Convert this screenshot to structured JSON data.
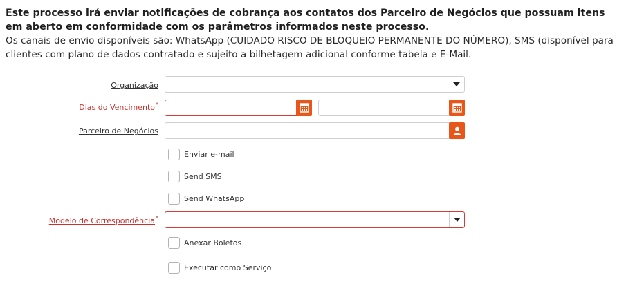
{
  "intro": {
    "bold_text": "Este processo irá enviar notificações de cobrança aos contatos dos Parceiro de Negócios que possuam itens em aberto em conformidade com os parâmetros informados neste processo.",
    "normal_text": "Os canais de envio disponíveis são: WhatsApp (CUIDADO RISCO DE BLOQUEIO PERMANENTE DO NÚMERO), SMS (disponível para clientes com plano de dados contratado e sujeito a bilhetagem adicional conforme tabela e E-Mail."
  },
  "form": {
    "organizacao": {
      "label": "Organização",
      "value": "",
      "required": false
    },
    "dias_vencimento": {
      "label": "Dias do Vencimento",
      "required_mark": "*",
      "from_value": "",
      "to_value": "",
      "required": true
    },
    "parceiro": {
      "label": "Parceiro de Negócios",
      "value": "",
      "required": false
    },
    "enviar_email": {
      "label": "Enviar e-mail",
      "checked": false
    },
    "send_sms": {
      "label": "Send SMS",
      "checked": false
    },
    "send_whatsapp": {
      "label": "Send WhatsApp",
      "checked": false
    },
    "modelo": {
      "label": "Modelo de Correspondência",
      "required_mark": "*",
      "value": "",
      "required": true
    },
    "anexar_boletos": {
      "label": "Anexar Boletos",
      "checked": false
    },
    "executar_servico": {
      "label": "Executar como Serviço",
      "checked": false
    }
  },
  "colors": {
    "accent": "#e8561a",
    "required": "#c8322f",
    "border": "#cfcfcf"
  },
  "icons": [
    "caret-down-icon",
    "calendar-icon",
    "person-icon"
  ]
}
